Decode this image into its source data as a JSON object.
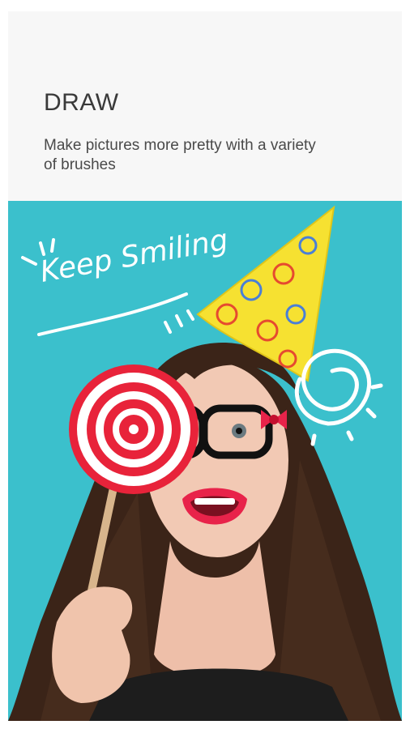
{
  "slide": {
    "title": "DRAW",
    "subtitle": "Make pictures more pretty with a variety of brushes"
  },
  "illustration": {
    "doodle_text": "Keep Smiling",
    "icons": [
      "party-hat",
      "lollipop",
      "swirl-doodle",
      "bow"
    ]
  },
  "colors": {
    "background": "#ffffff",
    "card": "#f7f7f7",
    "photo_bg": "#3fc5d0",
    "hat": "#f6e131",
    "lips": "#e8234a",
    "hair": "#3b2418"
  }
}
